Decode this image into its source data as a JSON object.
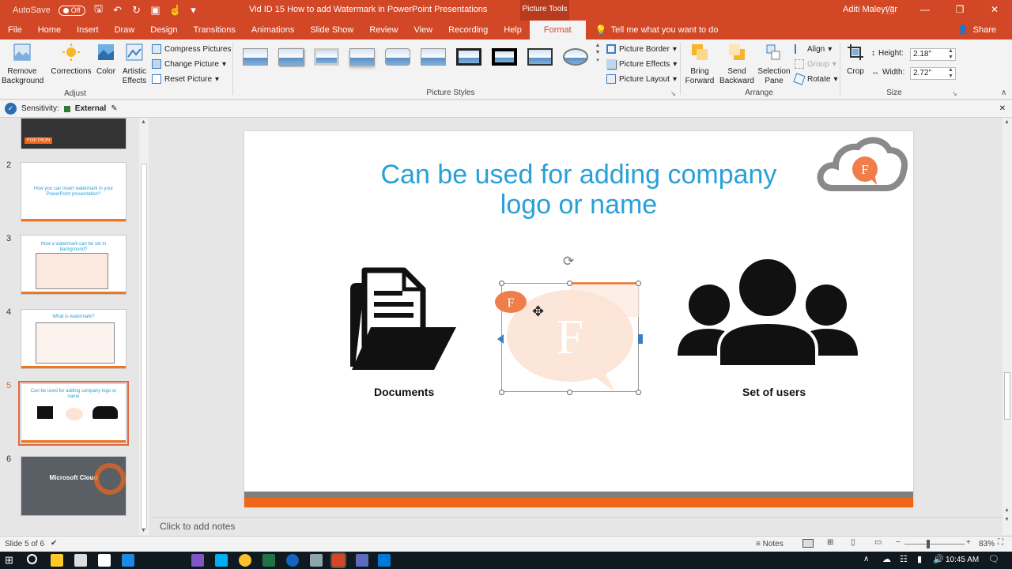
{
  "titlebar": {
    "autosave_label": "AutoSave",
    "autosave_state": "Off",
    "document_title": "Vid ID 15  How to add Watermark in PowerPoint Presentations",
    "tool_context": "Picture Tools",
    "user_name": "Aditi Maleyvar",
    "brand_color": "#d24726"
  },
  "tabs": [
    "File",
    "Home",
    "Insert",
    "Draw",
    "Design",
    "Transitions",
    "Animations",
    "Slide Show",
    "Review",
    "View",
    "Recording",
    "Help",
    "Format"
  ],
  "active_tab": "Format",
  "tellme_text": "Tell me what you want to do",
  "share_label": "Share",
  "ribbon": {
    "adjust": {
      "remove_background": "Remove Background",
      "corrections": "Corrections",
      "color": "Color",
      "artistic_effects": "Artistic Effects",
      "compress_pictures": "Compress Pictures",
      "change_picture": "Change Picture",
      "reset_picture": "Reset Picture",
      "group_label": "Adjust"
    },
    "picture_styles": {
      "group_label": "Picture Styles",
      "picture_border": "Picture Border",
      "picture_effects": "Picture Effects",
      "picture_layout": "Picture Layout"
    },
    "arrange": {
      "group_label": "Arrange",
      "bring_forward": "Bring Forward",
      "send_backward": "Send Backward",
      "selection_pane": "Selection Pane",
      "align": "Align",
      "group": "Group",
      "rotate": "Rotate"
    },
    "size": {
      "group_label": "Size",
      "crop": "Crop",
      "height_label": "Height:",
      "height_value": "2.18\"",
      "width_label": "Width:",
      "width_value": "2.72\""
    }
  },
  "sensitivity": {
    "label": "Sensitivity:",
    "value": "External"
  },
  "thumbnails": [
    {
      "num": "",
      "text": "FOETRON"
    },
    {
      "num": "2",
      "text": "How you can insert watermark in your PowerPoint presentation?"
    },
    {
      "num": "3",
      "text": "How a watermark can be set in background?"
    },
    {
      "num": "4",
      "text": "What is watermark?"
    },
    {
      "num": "5",
      "text": "Can be used for adding company logo or name"
    },
    {
      "num": "6",
      "text": "Microsoft Cloud"
    }
  ],
  "slide": {
    "title_line1": "Can be used for adding company",
    "title_line2": "logo or name",
    "documents_caption": "Documents",
    "users_caption": "Set of users",
    "logo_letter": "F",
    "accent_color": "#f06518",
    "title_color": "#2aa0d8"
  },
  "notes_placeholder": "Click to add notes",
  "status": {
    "slide_info": "Slide 5 of 6",
    "notes_label": "Notes",
    "zoom": "83%"
  },
  "taskbar": {
    "time": "10:45 AM"
  }
}
